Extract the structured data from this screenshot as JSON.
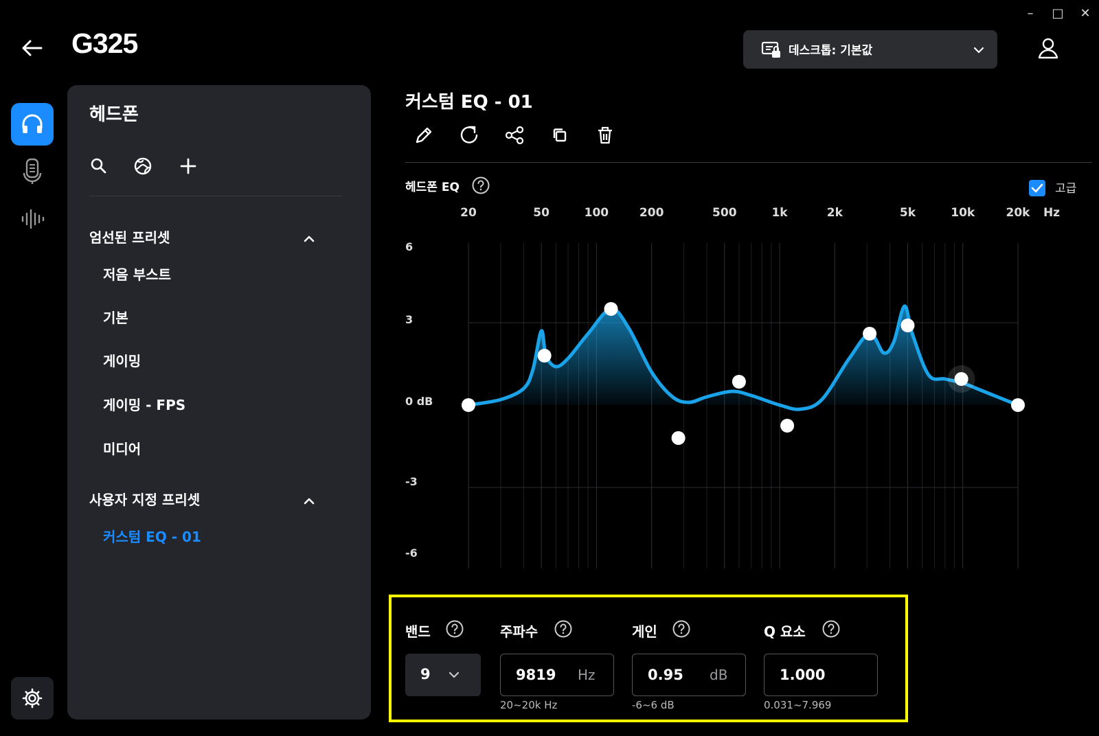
{
  "window": {
    "minimize": "–",
    "maximize": "□",
    "close": "✕"
  },
  "header": {
    "title": "G325",
    "profile_label": "데스크톱: 기본값",
    "icons": {
      "back": "back-arrow-icon",
      "user": "user-icon",
      "profile": "desktop-lock-icon"
    }
  },
  "rail": {
    "items": [
      {
        "icon": "headphones-icon",
        "active": true
      },
      {
        "icon": "microphone-icon",
        "active": false
      },
      {
        "icon": "equalizer-icon",
        "active": false
      }
    ],
    "settings_icon": "gear-icon"
  },
  "panel": {
    "title": "헤드폰",
    "tools": [
      "search-icon",
      "presets-globe-icon",
      "add-icon"
    ],
    "sections": [
      {
        "label": "엄선된 프리셋",
        "items": [
          "저음 부스트",
          "기본",
          "게이밍",
          "게이밍 - FPS",
          "미디어"
        ]
      },
      {
        "label": "사용자 지정 프리셋",
        "items": [
          "커스텀 EQ - 01"
        ]
      }
    ]
  },
  "main": {
    "title": "커스텀 EQ - 01",
    "tools": [
      "edit-icon",
      "reset-icon",
      "share-icon",
      "copy-icon",
      "delete-icon"
    ],
    "eq_label": "헤드폰 EQ",
    "advanced_label": "고급",
    "advanced_checked": true
  },
  "chart_data": {
    "type": "line",
    "x_scale": "log",
    "x_ticks": [
      "20",
      "50",
      "100",
      "200",
      "500",
      "1k",
      "2k",
      "5k",
      "10k",
      "20k"
    ],
    "x_unit": "Hz",
    "y_ticks": [
      "6",
      "3",
      "0 dB",
      "-3",
      "-6"
    ],
    "ylim": [
      -6,
      6
    ],
    "accent_color": "#1aa3e8",
    "points": [
      {
        "band": 1,
        "freq": 20,
        "gain": 0
      },
      {
        "band": 2,
        "freq": 52,
        "gain": 1.8
      },
      {
        "band": 3,
        "freq": 120,
        "gain": 3.5
      },
      {
        "band": 4,
        "freq": 280,
        "gain": -1.2
      },
      {
        "band": 5,
        "freq": 600,
        "gain": 0.85
      },
      {
        "band": 6,
        "freq": 1100,
        "gain": -0.75
      },
      {
        "band": 7,
        "freq": 3100,
        "gain": 2.6
      },
      {
        "band": 8,
        "freq": 5000,
        "gain": 2.9
      },
      {
        "band": 9,
        "freq": 9819,
        "gain": 0.95
      },
      {
        "band": 10,
        "freq": 20000,
        "gain": 0
      }
    ],
    "curve": [
      [
        20,
        0
      ],
      [
        30,
        0.2
      ],
      [
        40,
        0.6
      ],
      [
        45,
        1.3
      ],
      [
        50,
        2.7
      ],
      [
        53,
        1.8
      ],
      [
        60,
        1.4
      ],
      [
        70,
        1.7
      ],
      [
        90,
        2.6
      ],
      [
        120,
        3.5
      ],
      [
        150,
        2.8
      ],
      [
        200,
        1.2
      ],
      [
        260,
        0.3
      ],
      [
        320,
        0.1
      ],
      [
        400,
        0.3
      ],
      [
        550,
        0.5
      ],
      [
        700,
        0.35
      ],
      [
        1000,
        0.0
      ],
      [
        1300,
        -0.15
      ],
      [
        1700,
        0.2
      ],
      [
        2400,
        1.7
      ],
      [
        3100,
        2.6
      ],
      [
        3700,
        1.9
      ],
      [
        4200,
        2.3
      ],
      [
        4800,
        3.6
      ],
      [
        5300,
        2.6
      ],
      [
        6500,
        1.1
      ],
      [
        8000,
        0.95
      ],
      [
        10000,
        0.8
      ],
      [
        13000,
        0.5
      ],
      [
        20000,
        0
      ]
    ]
  },
  "controls": {
    "band": {
      "label": "밴드",
      "value": "9"
    },
    "frequency": {
      "label": "주파수",
      "value": "9819",
      "unit": "Hz",
      "range": "20~20k Hz"
    },
    "gain": {
      "label": "게인",
      "value": "0.95",
      "unit": "dB",
      "range": "-6~6 dB"
    },
    "q": {
      "label": "Q 요소",
      "value": "1.000",
      "range": "0.031~7.969"
    }
  }
}
